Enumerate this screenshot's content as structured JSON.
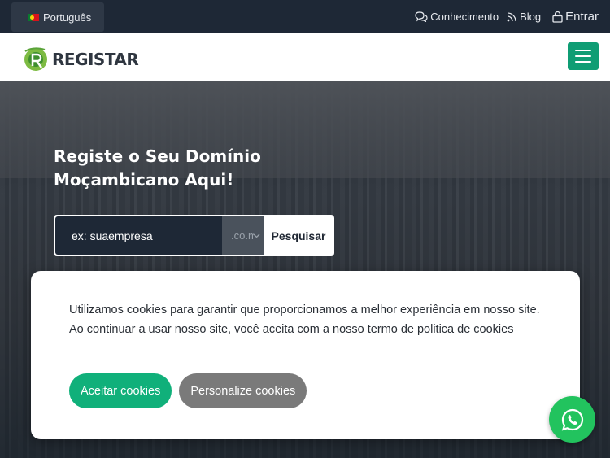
{
  "topbar": {
    "language": "Português",
    "links": {
      "knowledge": "Conhecimento",
      "blog": "Blog",
      "login": "Entrar"
    }
  },
  "header": {
    "logo_text": "REGISTAR"
  },
  "hero": {
    "title": "Registe o Seu Domínio Moçambicano Aqui!",
    "search": {
      "placeholder": "ex: suaempresa",
      "extension": ".co.mz",
      "button": "Pesquisar"
    }
  },
  "cookie_banner": {
    "line1": "Utilizamos cookies para garantir que proporcionamos a melhor experiência em nosso site.",
    "line2": "Ao continuar a usar nosso site, você aceita com a nosso termo de politica de cookies",
    "accept": "Aceitar cookies",
    "customize": "Personalize cookies"
  },
  "colors": {
    "brand_green": "#0f9d74",
    "accept_green": "#10b07a",
    "whatsapp_green": "#22c35e",
    "dark_navy": "#1e2836"
  },
  "icons": [
    "flag-portugal-icon",
    "chat-bubbles-icon",
    "rss-icon",
    "lock-icon",
    "hamburger-menu-icon",
    "chevron-down-icon",
    "whatsapp-icon"
  ]
}
